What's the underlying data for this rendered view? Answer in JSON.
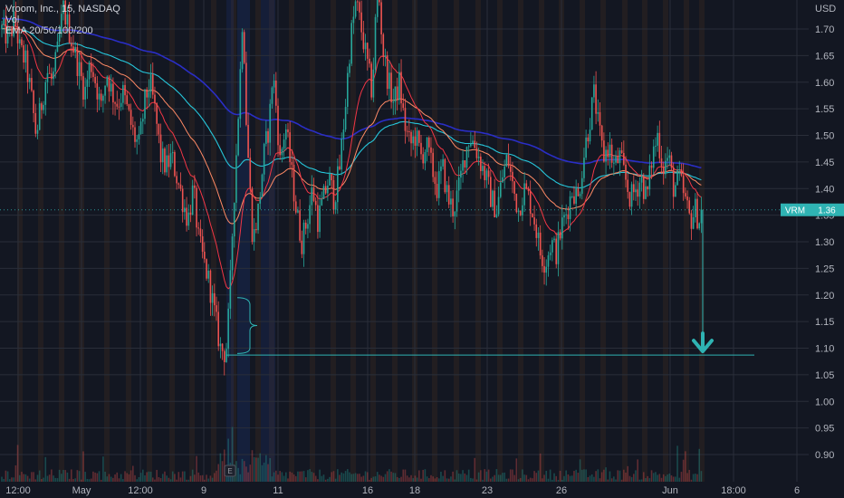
{
  "legend": {
    "symbol_line": "Vroom, Inc., 15, NASDAQ",
    "volume_label": "Vol",
    "ema_label": "EMA 20/50/100/200"
  },
  "price_axis": {
    "currency": "USD",
    "ticks": [
      "1.70",
      "1.65",
      "1.60",
      "1.55",
      "1.50",
      "1.45",
      "1.40",
      "1.35",
      "1.30",
      "1.25",
      "1.20",
      "1.15",
      "1.10",
      "1.05",
      "1.00",
      "0.95",
      "0.90"
    ]
  },
  "price_tag": {
    "symbol": "VRM",
    "price": "1.36"
  },
  "earnings_marker": "E",
  "chart_data": {
    "type": "line",
    "title": "Vroom, Inc., 15, NASDAQ",
    "xlabel": "",
    "ylabel": "USD",
    "ylim": [
      0.87,
      1.74
    ],
    "x_tick_labels": [
      "12:00",
      "May",
      "12:00",
      "9",
      "11",
      "16",
      "18",
      "23",
      "26",
      "Jun",
      "18:00",
      "6"
    ],
    "last_price": 1.36,
    "target_level": 1.087,
    "grid": true,
    "colors": {
      "up": "#26a69a",
      "down": "#ef5350",
      "ema20": "#f23645",
      "ema50": "#ff8a65",
      "ema100": "#26c6da",
      "ema200": "#2a2ec6",
      "annotation": "#2fb3b3",
      "session_bar": "#f57f17"
    },
    "price_path": [
      [
        0,
        1.7
      ],
      [
        8,
        1.68
      ],
      [
        14,
        1.72
      ],
      [
        20,
        1.66
      ],
      [
        26,
        1.64
      ],
      [
        32,
        1.58
      ],
      [
        38,
        1.5
      ],
      [
        44,
        1.56
      ],
      [
        50,
        1.62
      ],
      [
        56,
        1.6
      ],
      [
        62,
        1.66
      ],
      [
        68,
        1.74
      ],
      [
        74,
        1.7
      ],
      [
        80,
        1.66
      ],
      [
        86,
        1.62
      ],
      [
        92,
        1.58
      ],
      [
        98,
        1.64
      ],
      [
        104,
        1.6
      ],
      [
        110,
        1.55
      ],
      [
        116,
        1.62
      ],
      [
        122,
        1.58
      ],
      [
        128,
        1.56
      ],
      [
        134,
        1.58
      ],
      [
        140,
        1.54
      ],
      [
        146,
        1.5
      ],
      [
        152,
        1.48
      ],
      [
        158,
        1.56
      ],
      [
        164,
        1.6
      ],
      [
        170,
        1.54
      ],
      [
        176,
        1.46
      ],
      [
        182,
        1.44
      ],
      [
        188,
        1.46
      ],
      [
        194,
        1.42
      ],
      [
        200,
        1.38
      ],
      [
        206,
        1.34
      ],
      [
        212,
        1.4
      ],
      [
        218,
        1.3
      ],
      [
        224,
        1.26
      ],
      [
        230,
        1.22
      ],
      [
        236,
        1.16
      ],
      [
        242,
        1.1
      ],
      [
        248,
        1.09
      ],
      [
        252,
        1.18
      ],
      [
        256,
        1.35
      ],
      [
        260,
        1.48
      ],
      [
        264,
        1.62
      ],
      [
        267,
        1.75
      ],
      [
        270,
        1.55
      ],
      [
        274,
        1.42
      ],
      [
        278,
        1.3
      ],
      [
        284,
        1.36
      ],
      [
        290,
        1.46
      ],
      [
        296,
        1.52
      ],
      [
        300,
        1.62
      ],
      [
        304,
        1.55
      ],
      [
        308,
        1.45
      ],
      [
        314,
        1.52
      ],
      [
        320,
        1.44
      ],
      [
        326,
        1.36
      ],
      [
        332,
        1.3
      ],
      [
        338,
        1.34
      ],
      [
        344,
        1.4
      ],
      [
        350,
        1.34
      ],
      [
        356,
        1.38
      ],
      [
        362,
        1.42
      ],
      [
        368,
        1.38
      ],
      [
        374,
        1.44
      ],
      [
        380,
        1.55
      ],
      [
        386,
        1.68
      ],
      [
        392,
        1.75
      ],
      [
        398,
        1.7
      ],
      [
        404,
        1.64
      ],
      [
        410,
        1.58
      ],
      [
        416,
        1.8
      ],
      [
        422,
        1.66
      ],
      [
        428,
        1.6
      ],
      [
        434,
        1.56
      ],
      [
        440,
        1.6
      ],
      [
        446,
        1.52
      ],
      [
        452,
        1.48
      ],
      [
        458,
        1.5
      ],
      [
        464,
        1.46
      ],
      [
        470,
        1.48
      ],
      [
        476,
        1.44
      ],
      [
        482,
        1.4
      ],
      [
        488,
        1.44
      ],
      [
        494,
        1.38
      ],
      [
        500,
        1.36
      ],
      [
        506,
        1.4
      ],
      [
        512,
        1.46
      ],
      [
        518,
        1.5
      ],
      [
        524,
        1.48
      ],
      [
        530,
        1.45
      ],
      [
        536,
        1.42
      ],
      [
        542,
        1.38
      ],
      [
        548,
        1.36
      ],
      [
        554,
        1.42
      ],
      [
        560,
        1.46
      ],
      [
        566,
        1.4
      ],
      [
        572,
        1.36
      ],
      [
        578,
        1.4
      ],
      [
        584,
        1.38
      ],
      [
        590,
        1.34
      ],
      [
        596,
        1.28
      ],
      [
        602,
        1.26
      ],
      [
        608,
        1.3
      ],
      [
        614,
        1.28
      ],
      [
        620,
        1.33
      ],
      [
        626,
        1.36
      ],
      [
        632,
        1.4
      ],
      [
        638,
        1.38
      ],
      [
        644,
        1.46
      ],
      [
        650,
        1.52
      ],
      [
        656,
        1.58
      ],
      [
        660,
        1.52
      ],
      [
        666,
        1.46
      ],
      [
        672,
        1.48
      ],
      [
        678,
        1.44
      ],
      [
        684,
        1.46
      ],
      [
        690,
        1.42
      ],
      [
        696,
        1.38
      ],
      [
        702,
        1.4
      ],
      [
        708,
        1.42
      ],
      [
        714,
        1.38
      ],
      [
        720,
        1.46
      ],
      [
        726,
        1.5
      ],
      [
        732,
        1.44
      ],
      [
        738,
        1.46
      ],
      [
        744,
        1.4
      ],
      [
        750,
        1.42
      ],
      [
        756,
        1.38
      ],
      [
        762,
        1.34
      ],
      [
        768,
        1.36
      ],
      [
        772,
        1.34
      ],
      [
        775,
        1.36
      ]
    ]
  }
}
